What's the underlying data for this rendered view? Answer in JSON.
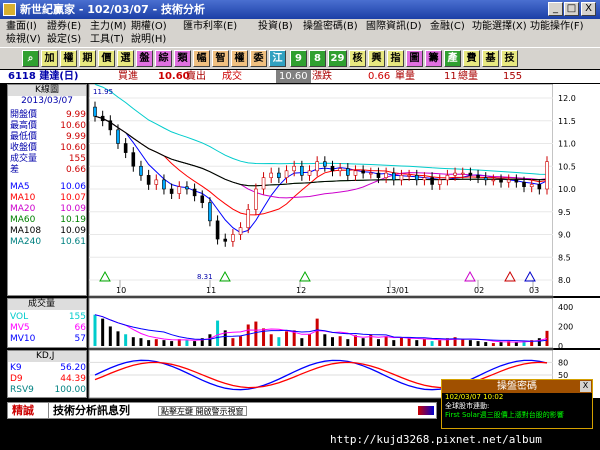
{
  "window": {
    "title": "新世紀贏家 - 102/03/07 - 技術分析",
    "buttons": [
      "_",
      "□",
      "X"
    ]
  },
  "menu": {
    "row1": [
      "畫面(I)",
      "證券(E)",
      "主力(M)",
      "期權(O)",
      "匯市利率(E)",
      "投資(B)",
      "操盤密碼(B)",
      "國際資訊(D)",
      "金融(C)",
      "功能選擇(X)",
      "功能操作(F)"
    ],
    "row2": [
      "檢視(V)",
      "設定(S)",
      "工具(T)",
      "說明(H)"
    ]
  },
  "toolbar": {
    "buttons": [
      "加",
      "權",
      "期",
      "價",
      "選",
      "盤",
      "綜",
      "類",
      "幅",
      "智",
      "權",
      "委",
      "江",
      "9",
      "8",
      "29",
      "核",
      "興",
      "指",
      "圖",
      "籌",
      "產",
      "費",
      "基",
      "技"
    ]
  },
  "quote": {
    "stock": "6118 建達(日)",
    "buy_label": "買進",
    "buy_value": "10.60",
    "sell_label": "賣出",
    "deal_label": "成交",
    "deal_value": "10.60",
    "change_label": "漲跌",
    "change_value": "0.66",
    "volume_label": "單量",
    "total_value": "11",
    "total_label": "總量",
    "total_volume": "155"
  },
  "info_panel": {
    "header": "K線圖",
    "date": "2013/03/07",
    "rows": [
      {
        "label": "開盤價",
        "value": "9.99"
      },
      {
        "label": "最高價",
        "value": "10.60"
      },
      {
        "label": "最低價",
        "value": "9.99"
      },
      {
        "label": "收盤價",
        "value": "10.60"
      },
      {
        "label": "成交量",
        "value": "155"
      },
      {
        "label": "差",
        "value": "0.66"
      }
    ],
    "ma": [
      {
        "label": "MA5",
        "value": "10.06",
        "color": "#0000ff"
      },
      {
        "label": "MA10",
        "value": "10.07",
        "color": "#ff0000"
      },
      {
        "label": "MA20",
        "value": "10.09",
        "color": "#cc00cc"
      },
      {
        "label": "MA60",
        "value": "10.19",
        "color": "#008000"
      },
      {
        "label": "MA108",
        "value": "10.09",
        "color": "#000000"
      },
      {
        "label": "MA240",
        "value": "10.61",
        "color": "#008080"
      }
    ]
  },
  "volume_panel": {
    "header": "成交量",
    "rows": [
      {
        "label": "VOL",
        "value": "155",
        "color": "#00cccc"
      },
      {
        "label": "MV5",
        "value": "66",
        "color": "#ff00ff"
      },
      {
        "label": "MV10",
        "value": "57",
        "color": "#0000ff"
      }
    ]
  },
  "kd_panel": {
    "header": "KD,J",
    "rows": [
      {
        "label": "K9",
        "value": "56.20",
        "color": "#0000ff"
      },
      {
        "label": "D9",
        "value": "44.39",
        "color": "#ff0000"
      },
      {
        "label": "RSV9",
        "value": "100.00",
        "color": "#008080"
      }
    ]
  },
  "chart_data": {
    "type": "candlestick",
    "price_axis": {
      "ticks": [
        "12.0",
        "11.5",
        "11.0",
        "10.5",
        "10.0",
        "9.5",
        "9.0",
        "8.5",
        "8.0"
      ],
      "range": [
        8.0,
        12.0
      ]
    },
    "volume_axis": {
      "ticks": [
        "400",
        "200",
        "0"
      ],
      "range": [
        0,
        450
      ]
    },
    "kd_axis": {
      "ticks": [
        "80",
        "50"
      ]
    },
    "x_labels": [
      "10",
      "11",
      "12",
      "13/01",
      "02",
      "03"
    ],
    "annotations": {
      "high": "11.95",
      "low": "8.31"
    },
    "closes": [
      11.6,
      11.5,
      11.3,
      11.0,
      10.8,
      10.5,
      10.3,
      10.1,
      10.2,
      10.0,
      9.9,
      10.05,
      10.0,
      9.85,
      9.7,
      9.3,
      8.9,
      8.85,
      9.0,
      9.15,
      9.55,
      10.0,
      10.25,
      10.35,
      10.25,
      10.4,
      10.5,
      10.3,
      10.4,
      10.6,
      10.5,
      10.4,
      10.45,
      10.3,
      10.4,
      10.35,
      10.35,
      10.25,
      10.35,
      10.2,
      10.3,
      10.3,
      10.2,
      10.25,
      10.1,
      10.2,
      10.3,
      10.35,
      10.35,
      10.3,
      10.25,
      10.2,
      10.2,
      10.15,
      10.2,
      10.15,
      10.05,
      10.1,
      10.0,
      10.6
    ],
    "volumes": [
      320,
      280,
      200,
      150,
      120,
      90,
      80,
      60,
      70,
      60,
      50,
      70,
      60,
      50,
      80,
      120,
      260,
      160,
      80,
      100,
      220,
      250,
      180,
      120,
      90,
      150,
      160,
      80,
      120,
      280,
      120,
      90,
      100,
      70,
      110,
      80,
      120,
      70,
      100,
      60,
      90,
      80,
      60,
      70,
      50,
      60,
      80,
      90,
      70,
      60,
      50,
      40,
      30,
      40,
      50,
      40,
      50,
      60,
      80,
      155
    ],
    "ma_colors": [
      "#0000ff",
      "#ff0000",
      "#cc00cc",
      "#008000",
      "#000000",
      "#00cccc"
    ]
  },
  "status": {
    "label": "精誠",
    "title": "技術分析訊息列",
    "message": "點擊左鍵 開啟警示視窗"
  },
  "popup": {
    "title": "操盤密碼",
    "close": "X",
    "time": "102/03/07  10:02",
    "line1": "全球股市連動:",
    "line2": "First Solar週三股價上漲對台股的影響"
  },
  "url": "http://kujd3268.pixnet.net/album"
}
